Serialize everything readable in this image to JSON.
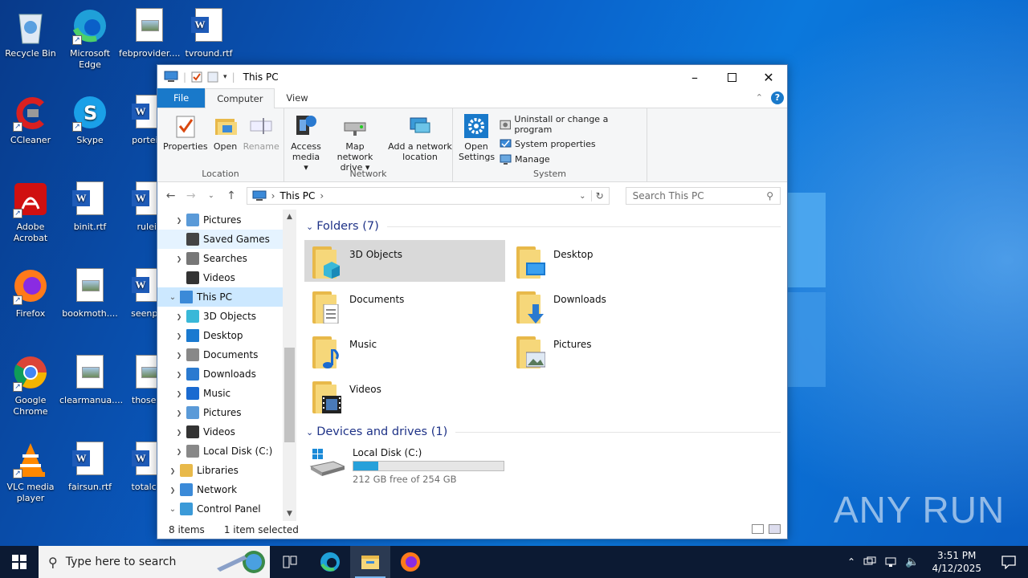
{
  "desktop": {
    "icons": [
      {
        "label": "Recycle Bin"
      },
      {
        "label": "Microsoft Edge"
      },
      {
        "label": "febprovider...."
      },
      {
        "label": "tvround.rtf"
      },
      {
        "label": "CCleaner"
      },
      {
        "label": "Skype"
      },
      {
        "label": "porteith"
      },
      {
        "label": "Adobe Acrobat"
      },
      {
        "label": "binit.rtf"
      },
      {
        "label": "ruleii."
      },
      {
        "label": "Firefox"
      },
      {
        "label": "bookmoth...."
      },
      {
        "label": "seenpas"
      },
      {
        "label": "Google Chrome"
      },
      {
        "label": "clearmanua...."
      },
      {
        "label": "thoseda"
      },
      {
        "label": "VLC media player"
      },
      {
        "label": "fairsun.rtf"
      },
      {
        "label": "totalcha"
      }
    ],
    "watermark": "ANY RUN"
  },
  "explorer": {
    "title": "This PC",
    "tabs": [
      "File",
      "Computer",
      "View"
    ],
    "help_label": "?",
    "ribbon": {
      "location": {
        "label": "Location",
        "properties": "Properties",
        "open": "Open",
        "rename": "Rename"
      },
      "network": {
        "label": "Network",
        "access_media": "Access media ▾",
        "map_drive": "Map network drive ▾",
        "add_location": "Add a network location"
      },
      "system": {
        "label": "System",
        "open_settings": "Open Settings",
        "uninstall": "Uninstall or change a program",
        "system_properties": "System properties",
        "manage": "Manage"
      }
    },
    "address": {
      "path": "This PC",
      "search_placeholder": "Search This PC"
    },
    "nav_items": [
      {
        "label": "Pictures",
        "icon": "pictures-icon",
        "indent": 1,
        "expander": "›"
      },
      {
        "label": "Saved Games",
        "icon": "saved-games-icon",
        "indent": 1,
        "expander": "",
        "state": "hover"
      },
      {
        "label": "Searches",
        "icon": "searches-icon",
        "indent": 1,
        "expander": "›"
      },
      {
        "label": "Videos",
        "icon": "videos-icon",
        "indent": 1,
        "expander": ""
      },
      {
        "label": "This PC",
        "icon": "pc-icon",
        "indent": 0,
        "expander": "⌄",
        "state": "selected"
      },
      {
        "label": "3D Objects",
        "icon": "3d-objects-icon",
        "indent": 1,
        "expander": "›"
      },
      {
        "label": "Desktop",
        "icon": "desktop-icon",
        "indent": 1,
        "expander": "›"
      },
      {
        "label": "Documents",
        "icon": "documents-icon",
        "indent": 1,
        "expander": "›"
      },
      {
        "label": "Downloads",
        "icon": "downloads-icon",
        "indent": 1,
        "expander": "›"
      },
      {
        "label": "Music",
        "icon": "music-icon",
        "indent": 1,
        "expander": "›"
      },
      {
        "label": "Pictures",
        "icon": "pictures-icon",
        "indent": 1,
        "expander": "›"
      },
      {
        "label": "Videos",
        "icon": "videos-icon",
        "indent": 1,
        "expander": "›"
      },
      {
        "label": "Local Disk (C:)",
        "icon": "local-disk-icon",
        "indent": 1,
        "expander": "›"
      },
      {
        "label": "Libraries",
        "icon": "libraries-icon",
        "indent": 0,
        "expander": "›"
      },
      {
        "label": "Network",
        "icon": "network-icon",
        "indent": 0,
        "expander": "›"
      },
      {
        "label": "Control Panel",
        "icon": "control-panel-icon",
        "indent": 0,
        "expander": "⌄"
      }
    ],
    "folders_header": "Folders (7)",
    "folders": [
      {
        "name": "3D Objects",
        "icon": "3d-objects-icon",
        "selected": true
      },
      {
        "name": "Desktop",
        "icon": "desktop-icon"
      },
      {
        "name": "Documents",
        "icon": "documents-icon"
      },
      {
        "name": "Downloads",
        "icon": "downloads-icon"
      },
      {
        "name": "Music",
        "icon": "music-icon"
      },
      {
        "name": "Pictures",
        "icon": "pictures-icon"
      },
      {
        "name": "Videos",
        "icon": "videos-icon"
      }
    ],
    "drives_header": "Devices and drives (1)",
    "drive": {
      "name": "Local Disk (C:)",
      "free_text": "212 GB free of 254 GB",
      "used_fraction": 0.165
    },
    "status": {
      "items": "8 items",
      "selected": "1 item selected"
    }
  },
  "taskbar": {
    "search_placeholder": "Type here to search",
    "time": "3:51 PM",
    "date": "4/12/2025"
  },
  "colors": {
    "accent": "#1979ca",
    "selection": "#cce8ff",
    "folder_header": "#1e3287",
    "drive_bar": "#26a0da"
  }
}
